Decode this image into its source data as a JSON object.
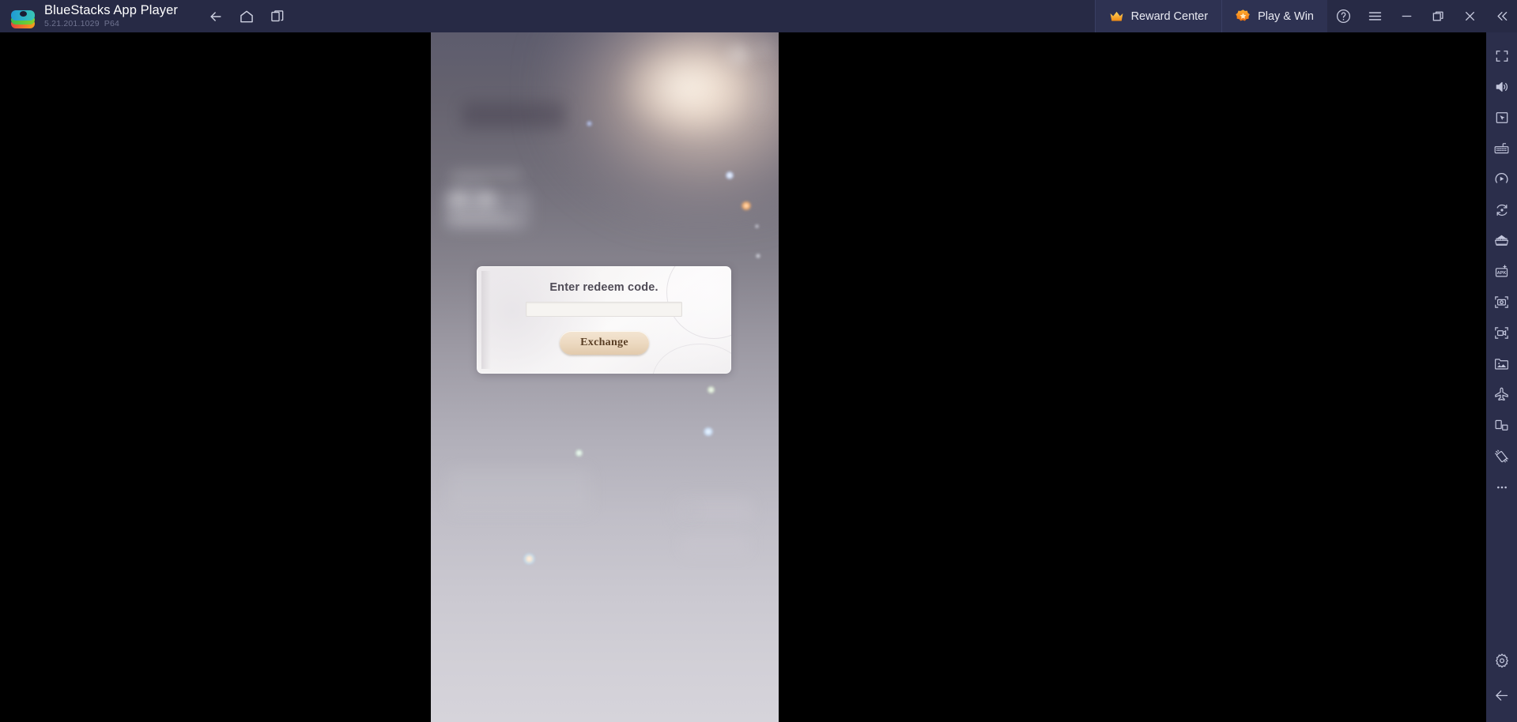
{
  "window": {
    "app_title": "BlueStacks App Player",
    "version": "5.21.201.1029",
    "build": "P64"
  },
  "titlebar": {
    "nav": [
      {
        "name": "back-button",
        "icon": "arrow-left-icon"
      },
      {
        "name": "home-button",
        "icon": "home-icon"
      },
      {
        "name": "instances-button",
        "icon": "multi-window-icon"
      }
    ],
    "promos": [
      {
        "label": "Reward Center",
        "icon": "crown-icon",
        "accent": "#f5a623"
      },
      {
        "label": "Play & Win",
        "icon": "star-badge-icon",
        "accent": "#f07b18"
      }
    ],
    "window_controls": [
      {
        "name": "help-button",
        "icon": "question-circle-icon"
      },
      {
        "name": "menu-button",
        "icon": "hamburger-icon"
      },
      {
        "name": "minimize-button",
        "icon": "minimize-icon"
      },
      {
        "name": "maximize-button",
        "icon": "restore-icon"
      },
      {
        "name": "close-button",
        "icon": "close-icon"
      },
      {
        "name": "collapse-sidebar-button",
        "icon": "chevrons-left-icon"
      }
    ]
  },
  "sidebar": {
    "items": [
      {
        "name": "fullscreen-button",
        "icon": "fullscreen-icon",
        "tooltip": "Full screen"
      },
      {
        "name": "volume-button",
        "icon": "speaker-icon",
        "tooltip": "Volume"
      },
      {
        "name": "game-controls-button",
        "icon": "cursor-screen-icon",
        "tooltip": "Game controls"
      },
      {
        "name": "keymapping-button",
        "icon": "keyboard-icon",
        "tooltip": "Keymapping"
      },
      {
        "name": "macro-button",
        "icon": "macro-play-icon",
        "tooltip": "Macro recorder"
      },
      {
        "name": "rotate-button",
        "icon": "rotate-icon",
        "tooltip": "Rotate"
      },
      {
        "name": "multi-instance-button",
        "icon": "instance-manager-icon",
        "tooltip": "Multi-instance manager"
      },
      {
        "name": "install-apk-button",
        "icon": "apk-icon",
        "tooltip": "Install APK"
      },
      {
        "name": "screenshot-button",
        "icon": "camera-icon",
        "tooltip": "Screenshot"
      },
      {
        "name": "record-button",
        "icon": "video-camera-icon",
        "tooltip": "Record screen"
      },
      {
        "name": "media-manager-button",
        "icon": "media-folder-icon",
        "tooltip": "Media manager"
      },
      {
        "name": "eco-mode-button",
        "icon": "airplane-icon",
        "tooltip": "Eco mode"
      },
      {
        "name": "resize-button",
        "icon": "resize-screen-icon",
        "tooltip": "Adjust screen"
      },
      {
        "name": "shake-button",
        "icon": "shake-device-icon",
        "tooltip": "Shake"
      },
      {
        "name": "more-button",
        "icon": "ellipsis-icon",
        "tooltip": "More"
      },
      {
        "name": "settings-button",
        "icon": "gear-icon",
        "tooltip": "Settings"
      },
      {
        "name": "back-nav-button",
        "icon": "arrow-left-icon",
        "tooltip": "Back"
      }
    ]
  },
  "game": {
    "dialog": {
      "title": "Enter redeem code.",
      "input_value": "",
      "input_placeholder": "",
      "submit_label": "Exchange"
    }
  },
  "colors": {
    "titlebar_bg": "#272a45",
    "sidebar_bg": "#2b2e4b",
    "promo_bg": "#2e3252",
    "stage_bg": "#000000",
    "dialog_bg": "#f7f5f5",
    "button_gold": "#eddac2",
    "button_text": "#5a3f25",
    "title_text": "#4f4b56"
  }
}
